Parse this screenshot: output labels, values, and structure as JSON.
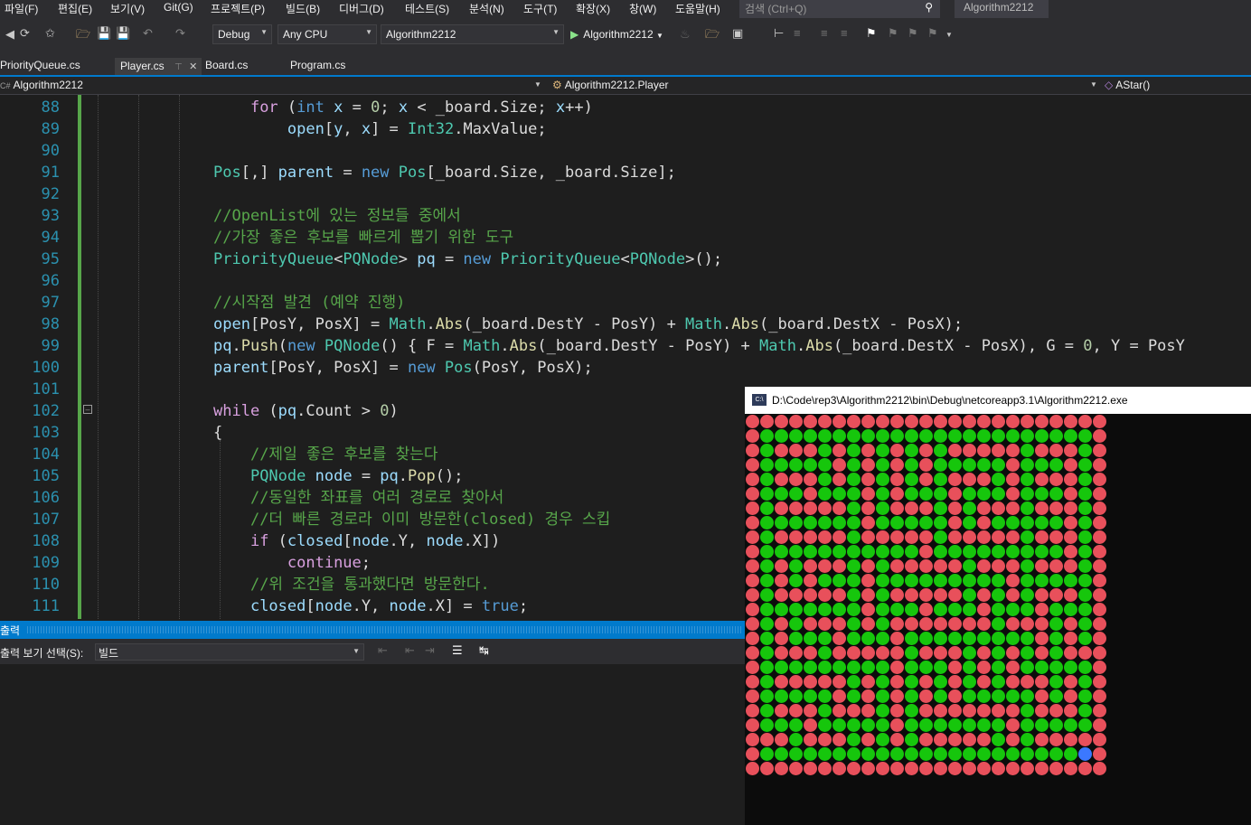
{
  "menu": {
    "items": [
      "파일(F)",
      "편집(E)",
      "보기(V)",
      "Git(G)",
      "프로젝트(P)",
      "빌드(B)",
      "디버그(D)",
      "테스트(S)",
      "분석(N)",
      "도구(T)",
      "확장(X)",
      "창(W)",
      "도움말(H)"
    ],
    "search_placeholder": "검색 (Ctrl+Q)",
    "solution_title": "Algorithm2212"
  },
  "toolbar": {
    "config": "Debug",
    "platform": "Any CPU",
    "startup_project": "Algorithm2212",
    "run_label": "Algorithm2212"
  },
  "tabs": [
    "PriorityQueue.cs",
    "Player.cs",
    "Board.cs",
    "Program.cs"
  ],
  "nav": {
    "project": "Algorithm2212",
    "class": "Algorithm2212.Player",
    "member": "AStar()"
  },
  "editor": {
    "line_numbers": [
      "88",
      "89",
      "90",
      "91",
      "92",
      "93",
      "94",
      "95",
      "96",
      "97",
      "98",
      "99",
      "100",
      "101",
      "102",
      "103",
      "104",
      "105",
      "106",
      "107",
      "108",
      "109",
      "110",
      "111"
    ],
    "lines": [
      [
        [
          "    ",
          "t"
        ],
        [
          "for",
          "ctl"
        ],
        [
          " (",
          "t"
        ],
        [
          "int",
          "kw"
        ],
        [
          " ",
          "t"
        ],
        [
          "x",
          "mb"
        ],
        [
          " = ",
          "t"
        ],
        [
          "0",
          "num"
        ],
        [
          "; ",
          "t"
        ],
        [
          "x",
          "mb"
        ],
        [
          " < _board.Size; ",
          "t"
        ],
        [
          "x",
          "mb"
        ],
        [
          "++)",
          "t"
        ]
      ],
      [
        [
          "        ",
          "t"
        ],
        [
          "open",
          "mb"
        ],
        [
          "[",
          "t"
        ],
        [
          "y",
          "mb"
        ],
        [
          ", ",
          "t"
        ],
        [
          "x",
          "mb"
        ],
        [
          "] = ",
          "t"
        ],
        [
          "Int32",
          "ty"
        ],
        [
          ".MaxValue;",
          "t"
        ]
      ],
      [],
      [
        [
          "Pos",
          "ty"
        ],
        [
          "[,] ",
          "t"
        ],
        [
          "parent",
          "mb"
        ],
        [
          " = ",
          "t"
        ],
        [
          "new",
          "kw"
        ],
        [
          " ",
          "t"
        ],
        [
          "Pos",
          "ty"
        ],
        [
          "[_board.Size, _board.Size];",
          "t"
        ]
      ],
      [],
      [
        [
          "//OpenList에 있는 정보들 중에서",
          "cm"
        ]
      ],
      [
        [
          "//가장 좋은 후보를 빠르게 뽑기 위한 도구",
          "cm"
        ]
      ],
      [
        [
          "PriorityQueue",
          "ty"
        ],
        [
          "<",
          "t"
        ],
        [
          "PQNode",
          "ty"
        ],
        [
          "> ",
          "t"
        ],
        [
          "pq",
          "mb"
        ],
        [
          " = ",
          "t"
        ],
        [
          "new",
          "kw"
        ],
        [
          " ",
          "t"
        ],
        [
          "PriorityQueue",
          "ty"
        ],
        [
          "<",
          "t"
        ],
        [
          "PQNode",
          "ty"
        ],
        [
          ">();",
          "t"
        ]
      ],
      [],
      [
        [
          "//시작점 발견 (예약 진행)",
          "cm"
        ]
      ],
      [
        [
          "open",
          "mb"
        ],
        [
          "[PosY, PosX] = ",
          "t"
        ],
        [
          "Math",
          "ty"
        ],
        [
          ".",
          "t"
        ],
        [
          "Abs",
          "mt"
        ],
        [
          "(_board.DestY - PosY) + ",
          "t"
        ],
        [
          "Math",
          "ty"
        ],
        [
          ".",
          "t"
        ],
        [
          "Abs",
          "mt"
        ],
        [
          "(_board.DestX - PosX);",
          "t"
        ]
      ],
      [
        [
          "pq",
          "mb"
        ],
        [
          ".",
          "t"
        ],
        [
          "Push",
          "mt"
        ],
        [
          "(",
          "t"
        ],
        [
          "new",
          "kw"
        ],
        [
          " ",
          "t"
        ],
        [
          "PQNode",
          "ty"
        ],
        [
          "() { F = ",
          "t"
        ],
        [
          "Math",
          "ty"
        ],
        [
          ".",
          "t"
        ],
        [
          "Abs",
          "mt"
        ],
        [
          "(_board.DestY - PosY) + ",
          "t"
        ],
        [
          "Math",
          "ty"
        ],
        [
          ".",
          "t"
        ],
        [
          "Abs",
          "mt"
        ],
        [
          "(_board.DestX - PosX), G = ",
          "t"
        ],
        [
          "0",
          "num"
        ],
        [
          ", Y = PosY",
          "t"
        ]
      ],
      [
        [
          "parent",
          "mb"
        ],
        [
          "[PosY, PosX] = ",
          "t"
        ],
        [
          "new",
          "kw"
        ],
        [
          " ",
          "t"
        ],
        [
          "Pos",
          "ty"
        ],
        [
          "(PosY, PosX);",
          "t"
        ]
      ],
      [],
      [
        [
          "while",
          "ctl"
        ],
        [
          " (",
          "t"
        ],
        [
          "pq",
          "mb"
        ],
        [
          ".Count > ",
          "t"
        ],
        [
          "0",
          "num"
        ],
        [
          ")",
          "t"
        ]
      ],
      [
        [
          "{",
          "t"
        ]
      ],
      [
        [
          "    ",
          "t"
        ],
        [
          "//제일 좋은 후보를 찾는다",
          "cm"
        ]
      ],
      [
        [
          "    ",
          "t"
        ],
        [
          "PQNode",
          "ty"
        ],
        [
          " ",
          "t"
        ],
        [
          "node",
          "mb"
        ],
        [
          " = ",
          "t"
        ],
        [
          "pq",
          "mb"
        ],
        [
          ".",
          "t"
        ],
        [
          "Pop",
          "mt"
        ],
        [
          "();",
          "t"
        ]
      ],
      [
        [
          "    ",
          "t"
        ],
        [
          "//동일한 좌표를 여러 경로로 찾아서",
          "cm"
        ]
      ],
      [
        [
          "    ",
          "t"
        ],
        [
          "//더 빠른 경로라 이미 방문한(closed) 경우 스킵",
          "cm"
        ]
      ],
      [
        [
          "    ",
          "t"
        ],
        [
          "if",
          "ctl"
        ],
        [
          " (",
          "t"
        ],
        [
          "closed",
          "mb"
        ],
        [
          "[",
          "t"
        ],
        [
          "node",
          "mb"
        ],
        [
          ".Y, ",
          "t"
        ],
        [
          "node",
          "mb"
        ],
        [
          ".X])",
          "t"
        ]
      ],
      [
        [
          "        ",
          "t"
        ],
        [
          "continue",
          "ctl"
        ],
        [
          ";",
          "t"
        ]
      ],
      [
        [
          "    ",
          "t"
        ],
        [
          "//위 조건을 통과했다면 방문한다.",
          "cm"
        ]
      ],
      [
        [
          "    ",
          "t"
        ],
        [
          "closed",
          "mb"
        ],
        [
          "[",
          "t"
        ],
        [
          "node",
          "mb"
        ],
        [
          ".Y, ",
          "t"
        ],
        [
          "node",
          "mb"
        ],
        [
          ".X] = ",
          "t"
        ],
        [
          "true",
          "kw"
        ],
        [
          ";",
          "t"
        ]
      ]
    ]
  },
  "output": {
    "title": "출력",
    "select_label": "출력 보기 선택(S):",
    "selected_value": "빌드"
  },
  "console": {
    "title": "D:\\Code\\rep3\\Algorithm2212\\bin\\Debug\\netcoreapp3.1\\Algorithm2212.exe",
    "icon_text": "C:\\",
    "colors": {
      "wall": "#e8505b",
      "empty": "#16c60c",
      "player": "#3b78ff"
    },
    "maze": [
      "WWWWWWWWWWWWWWWWWWWWWWWWW",
      "WEEEEEEEEEEEEEEEEEEEEEEEW",
      "WEWWWEWEWEWEWEWWWWWEWWWEW",
      "WEEEEEWEWEWEWEEEEEWEEEWEW",
      "WEWWWEWEWEWEWEWWWEWEWWWEW",
      "WEEEWEEEWEWEEEWEEEWEEEWEW",
      "WEWWWWWEWEWWWEWEWWWEWWWEW",
      "WEEEEEEEWEEEEEWEWEEEEEWEW",
      "WEWWWWWEWWWWWEWWWWWEWWWEW",
      "WEEEEEEEEEEEWEEEEEEEEEWEW",
      "WEWEWWWEWEWWWWWEWWWEWWWEW",
      "WEWEWEEEWEEEEEEEEEWEEEEEW",
      "WEWWWWWEWEWWWWWEWEWEWWWEW",
      "WEEEEEEEWEEEWEEEWEEEWEEEW",
      "WEWEWWWEWEWWWWWWWEWWWEWEW",
      "WEWEEEWEEEWEEEEEEEEEWEWEW",
      "WEWWWEWWWWWEWWWEWEWEWEWWW",
      "WEEEEEEEEEWEEEWEWEWEEEEEW",
      "WEWWWWWEWEWEWEWEWEWWWEWEW",
      "WEEEEEWEWEWEWEWEEEEEWEWEW",
      "WEWWWEWWWEWEWWWWWWWEWWWEW",
      "WEEEWEEEEEWEEEEEEEWEEEEEW",
      "WWWEWWWEWEWEWWWWWEWEWWWWW",
      "WEEEEEEEEEEEEEEEEEEEEEEPW",
      "WWWWWWWWWWWWWWWWWWWWWWWWW"
    ]
  }
}
